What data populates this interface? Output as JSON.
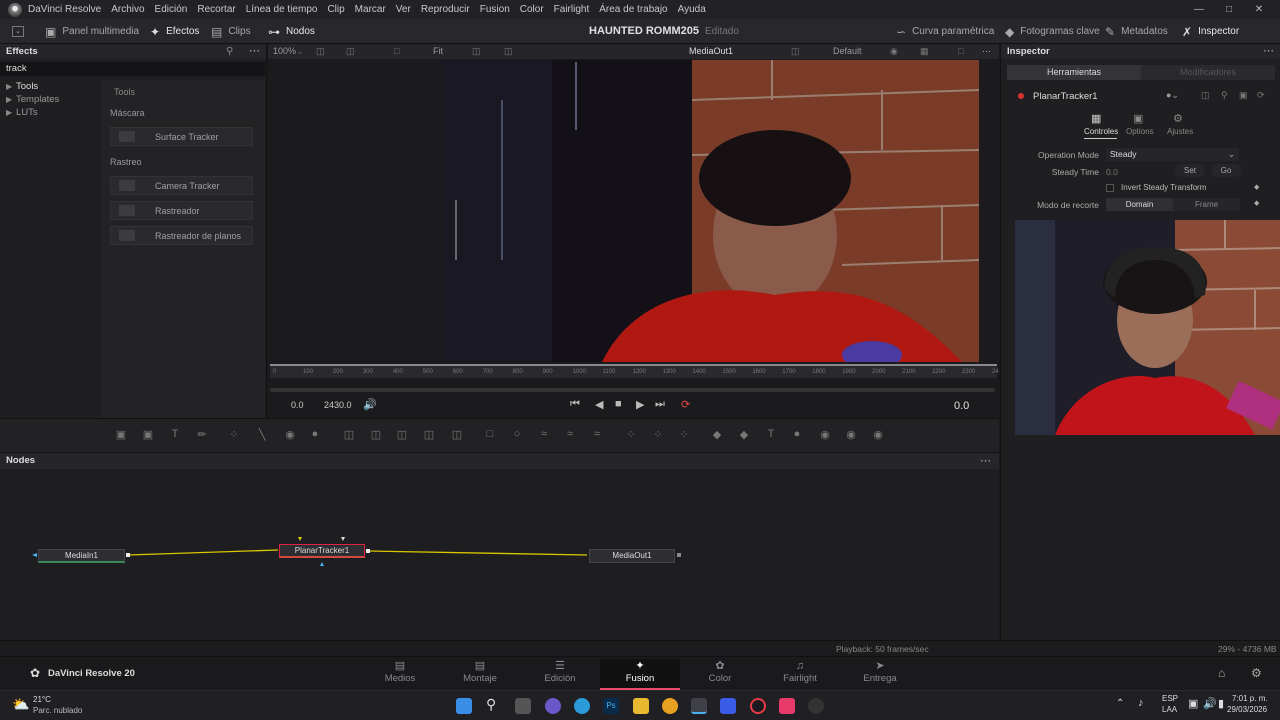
{
  "titlebar": {
    "app_name": "DaVinci Resolve",
    "menu": [
      "Archivo",
      "Edición",
      "Recortar",
      "Línea de tiempo",
      "Clip",
      "Marcar",
      "Ver",
      "Reproducir",
      "Fusion",
      "Color",
      "Fairlight",
      "Área de trabajo",
      "Ayuda"
    ]
  },
  "toolbar": {
    "media_panel": "Panel multimedia",
    "effects": "Efectos",
    "clips": "Clips",
    "nodes": "Nodos",
    "project_title": "HAUNTED  ROMM205",
    "project_status": "Editado",
    "parametric_curve": "Curva paramétrica",
    "keyframes": "Fotogramas clave",
    "metadata": "Metadatos",
    "inspector": "Inspector"
  },
  "effects": {
    "title": "Effects",
    "search_value": "track",
    "tree": [
      "Tools",
      "Templates",
      "LUTs"
    ],
    "header": "Tools",
    "categories": [
      {
        "name": "Máscara",
        "tools": [
          "Surface Tracker"
        ]
      },
      {
        "name": "Rastreo",
        "tools": [
          "Camera Tracker",
          "Rastreador",
          "Rastreador de planos"
        ]
      }
    ]
  },
  "viewer": {
    "zoom": "100%",
    "fit": "Fit",
    "output_name": "MediaOut1",
    "lut": "Default",
    "ruler_ticks": [
      "0",
      "100",
      "200",
      "300",
      "400",
      "500",
      "600",
      "700",
      "800",
      "900",
      "1000",
      "1100",
      "1200",
      "1300",
      "1400",
      "1500",
      "1600",
      "1700",
      "1800",
      "1900",
      "2000",
      "2100",
      "2200",
      "2300",
      "24"
    ],
    "start_time": "0.0",
    "end_time": "2430.0",
    "current_time": "0.0"
  },
  "nodes_panel": {
    "title": "Nodes",
    "nodes": [
      "MediaIn1",
      "PlanarTracker1",
      "MediaOut1"
    ]
  },
  "inspector": {
    "title": "Inspector",
    "tab_tools": "Herramientas",
    "tab_modifiers": "Modificadores",
    "node_name": "PlanarTracker1",
    "subtabs": [
      "Controles",
      "Options",
      "Ajustes"
    ],
    "operation_mode_label": "Operation Mode",
    "operation_mode_value": "Steady",
    "steady_time_label": "Steady Time",
    "steady_time_value": "0.0",
    "set_label": "Set",
    "go_label": "Go",
    "invert_label": "Invert Steady Transform",
    "crop_mode_label": "Modo de recorte",
    "crop_domain": "Domain",
    "crop_frame": "Frame"
  },
  "statusbar": {
    "playback": "Playback: 50 frames/sec",
    "memory": "29% - 4736 MB"
  },
  "pagebar": {
    "brand": "DaVinci Resolve 20",
    "pages": [
      "Medios",
      "Montaje",
      "Edición",
      "Fusion",
      "Color",
      "Fairlight",
      "Entrega"
    ],
    "active_page": "Fusion"
  },
  "taskbar": {
    "temperature": "21°C",
    "weather": "Parc. nublado",
    "lang_top": "ESP",
    "lang_bottom": "LAA",
    "time": "7:01 p. m.",
    "date": "29/03/2026"
  },
  "colors": {
    "accent_red": "#e84a6a",
    "node_line": "#d8c800"
  }
}
